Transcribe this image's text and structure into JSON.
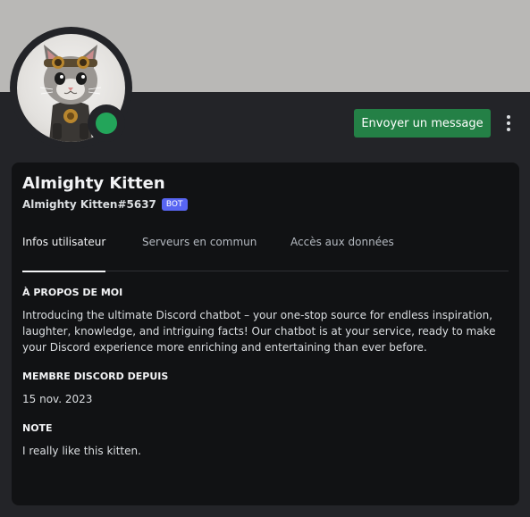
{
  "profile": {
    "display_name": "Almighty Kitten",
    "username": "Almighty Kitten#5637",
    "bot_badge": "BOT",
    "status": "online",
    "status_color": "#23a55a",
    "banner_color": "#b9b8b6",
    "avatar_icon": "steampunk-kitten-avatar"
  },
  "actions": {
    "send_message_label": "Envoyer un message",
    "more_icon": "more-vertical-icon"
  },
  "tabs": [
    {
      "label": "Infos utilisateur",
      "active": true
    },
    {
      "label": "Serveurs en commun",
      "active": false
    },
    {
      "label": "Accès aux données",
      "active": false
    }
  ],
  "about": {
    "title": "À PROPOS DE MOI",
    "text": "Introducing the ultimate Discord chatbot – your one-stop source for endless inspiration, laughter, knowledge, and intriguing facts! Our chatbot is at your service, ready to make your Discord experience more enriching and entertaining than ever before."
  },
  "member_since": {
    "title": "MEMBRE DISCORD DEPUIS",
    "date": "15 nov. 2023"
  },
  "note": {
    "title": "NOTE",
    "text": "I really like this kitten."
  },
  "colors": {
    "accent_button": "#248046",
    "badge": "#5865f2"
  }
}
